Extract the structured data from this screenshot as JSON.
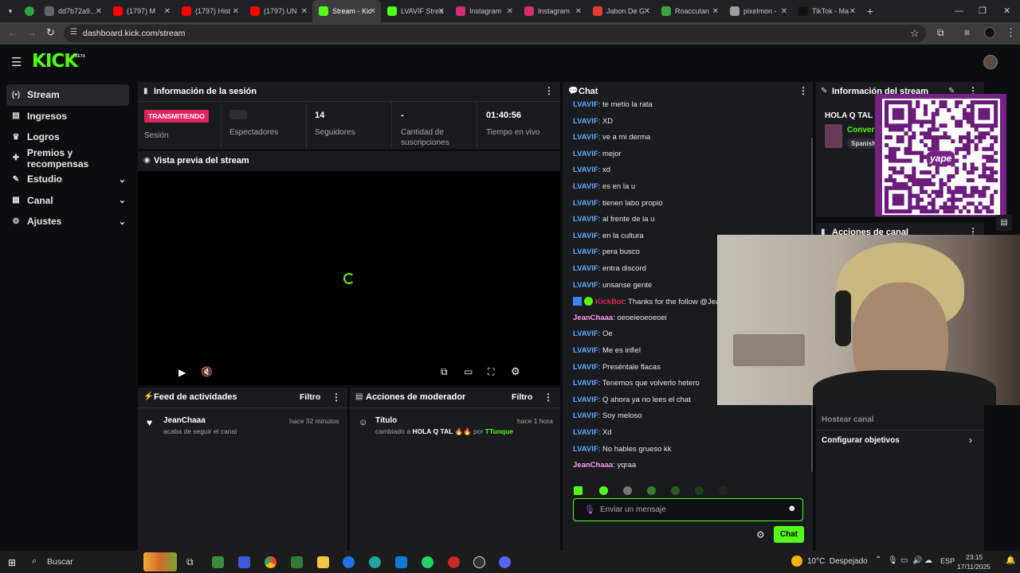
{
  "browser": {
    "tabs": [
      {
        "label": "dd7b72a9...",
        "color": "#5f6368"
      },
      {
        "label": "(1797) M",
        "color": "#ff0000"
      },
      {
        "label": "(1797) Hist",
        "color": "#ff0000"
      },
      {
        "label": "(1797) UN",
        "color": "#ff0000"
      },
      {
        "label": "Stream - Kic",
        "color": "#53fc18"
      },
      {
        "label": "LVAVIF Strea",
        "color": "#53fc18"
      },
      {
        "label": "Instagram",
        "color": "#d62976"
      },
      {
        "label": "Instagram",
        "color": "#d62976"
      },
      {
        "label": "Jabon De G",
        "color": "#e53935"
      },
      {
        "label": "Roaccutan",
        "color": "#43a047"
      },
      {
        "label": "pixelmon -",
        "color": "#9e9e9e"
      },
      {
        "label": "TikTok - Ma",
        "color": "#111111"
      }
    ],
    "active_tab": 4,
    "url": "dashboard.kick.com/stream"
  },
  "brand": {
    "logo": "KICK",
    "beta": "BETA",
    "accent": "#53fc18"
  },
  "sidebar": {
    "items": [
      {
        "label": "Stream",
        "icon": "stream-icon",
        "glyph": "((•))"
      },
      {
        "label": "Ingresos",
        "icon": "income-icon",
        "glyph": "▤"
      },
      {
        "label": "Logros",
        "icon": "trophy-icon",
        "glyph": "🏆"
      },
      {
        "label": "Premios y recompensas",
        "icon": "gift-icon",
        "glyph": "🎁"
      },
      {
        "label": "Estudio",
        "icon": "studio-icon",
        "glyph": "✎"
      },
      {
        "label": "Canal",
        "icon": "channel-icon",
        "glyph": "▦"
      },
      {
        "label": "Ajustes",
        "icon": "gear-icon",
        "glyph": "⚙"
      }
    ]
  },
  "session": {
    "title": "Información de la sesión",
    "badge": "TRANSMITIENDO",
    "badge_label": "Sesión",
    "stats": [
      {
        "value": "",
        "label": "Espectadores"
      },
      {
        "value": "14",
        "label": "Seguidores"
      },
      {
        "value": "-",
        "label": "Cantidad de suscripciones"
      },
      {
        "value": "01:40:56",
        "label": "Tiempo en vivo"
      }
    ]
  },
  "preview": {
    "title": "Vista previa del stream"
  },
  "activity": {
    "title": "Feed de actividades",
    "filter": "Filtro",
    "items": [
      {
        "user": "JeanChaaa",
        "text": "acaba de seguir el canal",
        "time": "hace 32 minutos"
      }
    ]
  },
  "moderator": {
    "title": "Acciones de moderador",
    "filter": "Filtro",
    "items": [
      {
        "title": "Título",
        "prefix": "cambiado a",
        "value": "HOLA Q TAL 🔥🔥",
        "by": "por",
        "user": "TTunque",
        "time": "hace 1 hora"
      }
    ]
  },
  "chat": {
    "title": "Chat",
    "messages": [
      {
        "user": "LVAVIF",
        "text": "te metio la rata",
        "color": "#5fa8ff"
      },
      {
        "user": "LVAVIF",
        "text": "XD",
        "color": "#5fa8ff"
      },
      {
        "user": "LVAVIF",
        "text": "ve a mi derma",
        "color": "#5fa8ff"
      },
      {
        "user": "LVAVIF",
        "text": "mejor",
        "color": "#5fa8ff"
      },
      {
        "user": "LVAVIF",
        "text": "xd",
        "color": "#5fa8ff"
      },
      {
        "user": "LVAVIF",
        "text": "es en la u",
        "color": "#5fa8ff"
      },
      {
        "user": "LVAVIF",
        "text": "tienen labo propio",
        "color": "#5fa8ff"
      },
      {
        "user": "LVAVIF",
        "text": "al frente de la u",
        "color": "#5fa8ff"
      },
      {
        "user": "LVAVIF",
        "text": "en la cultura",
        "color": "#5fa8ff"
      },
      {
        "user": "LVAVIF",
        "text": "pera busco",
        "color": "#5fa8ff"
      },
      {
        "user": "LVAVIF",
        "text": "entra discord",
        "color": "#5fa8ff"
      },
      {
        "user": "LVAVIF",
        "text": "unsanse gente",
        "color": "#5fa8ff"
      },
      {
        "user": "KickBot",
        "text": "Thanks for the follow @Jea",
        "color": "#e0245e"
      },
      {
        "user": "JeanChaaa",
        "text": "oeoeieoeoeoei",
        "color": "#ff9ff3"
      },
      {
        "user": "LVAVIF",
        "text": "Oe",
        "color": "#5fa8ff"
      },
      {
        "user": "LVAVIF",
        "text": "Me es infiel",
        "color": "#5fa8ff"
      },
      {
        "user": "LVAVIF",
        "text": "Preséntale flacas",
        "color": "#5fa8ff"
      },
      {
        "user": "LVAVIF",
        "text": "Tenemos que volverlo hetero",
        "color": "#5fa8ff"
      },
      {
        "user": "LVAVIF",
        "text": "Q ahora ya no lees el chat",
        "color": "#5fa8ff"
      },
      {
        "user": "LVAVIF",
        "text": "Soy meloso",
        "color": "#5fa8ff"
      },
      {
        "user": "LVAVIF",
        "text": "Xd",
        "color": "#5fa8ff"
      },
      {
        "user": "LVAVIF",
        "text": "No hables grueso kk",
        "color": "#5fa8ff"
      },
      {
        "user": "JeanChaaa",
        "text": "yqraa",
        "color": "#ff9ff3"
      }
    ],
    "input_placeholder": "Enviar un mensaje",
    "send_label": "Chat"
  },
  "stream_info": {
    "title": "Información del stream",
    "stream_title": "HOLA Q TAL",
    "category": "Convers",
    "language": "Spanish",
    "qr_caption": "yape"
  },
  "channel_actions": {
    "title": "Acciones de canal",
    "host": "Hostear canal",
    "goals": "Configurar objetivos"
  },
  "taskbar": {
    "search": "Buscar",
    "weather": "10°C  Despejado",
    "lang": "ESP",
    "time": "23:15",
    "date": "17/11/2025"
  }
}
